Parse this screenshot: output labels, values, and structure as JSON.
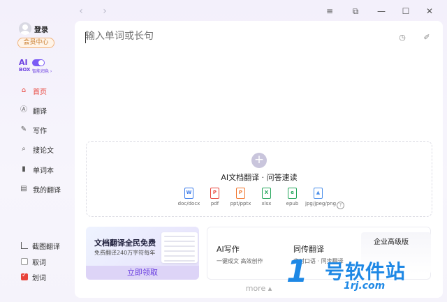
{
  "titlebar": {
    "back_icon": "chevron-left-icon",
    "forward_icon": "chevron-right-icon",
    "menu_icon": "hamburger-menu-icon",
    "pin_icon": "pin-window-icon",
    "minimize_icon": "minimize-icon",
    "maximize_icon": "maximize-icon",
    "close_icon": "close-icon"
  },
  "sidebar": {
    "login_label": "登录",
    "vip_label": "会员中心",
    "aibox": {
      "logo_line1": "AI",
      "logo_line2": "BOX",
      "subtitle": "智能润色 ›"
    },
    "nav_items": [
      {
        "label": "首页",
        "icon": "home-icon",
        "active": true
      },
      {
        "label": "翻译",
        "icon": "translate-icon",
        "active": false
      },
      {
        "label": "写作",
        "icon": "pen-icon",
        "active": false
      },
      {
        "label": "搜论文",
        "icon": "paper-search-icon",
        "active": false
      },
      {
        "label": "单词本",
        "icon": "wordbook-icon",
        "active": false
      },
      {
        "label": "我的翻译",
        "icon": "my-translation-icon",
        "active": false
      }
    ],
    "bottom_items": [
      {
        "label": "截图翻译",
        "icon": "crop-icon"
      },
      {
        "label": "取词",
        "checked": false
      },
      {
        "label": "划词",
        "checked": true
      }
    ]
  },
  "main": {
    "input_placeholder": "输入单词或长句",
    "history_icon": "clock-icon",
    "edit_icon": "edit-pen-icon",
    "drop_zone": {
      "plus_icon": "+",
      "title": "AI文档翻译 · 问答速读",
      "file_types": [
        {
          "label": "doc/docx",
          "glyph": "W",
          "color": "#3b7bea"
        },
        {
          "label": "pdf",
          "glyph": "P",
          "color": "#e8433a"
        },
        {
          "label": "ppt/pptx",
          "glyph": "P",
          "color": "#f0762e"
        },
        {
          "label": "xlsx",
          "glyph": "X",
          "color": "#23a55a"
        },
        {
          "label": "epub",
          "glyph": "e",
          "color": "#23a55a"
        },
        {
          "label": "jpg/jpeg/png",
          "glyph": "▲",
          "color": "#4b8fea"
        }
      ],
      "help_icon": "?"
    },
    "promo": {
      "title": "文档翻译全民免费",
      "subtitle": "免费翻译240万字符每年",
      "button": "立即领取"
    },
    "features": [
      {
        "title": "AI写作",
        "subtitle": "一键成文 高效创作"
      },
      {
        "title": "同传翻译",
        "subtitle": "实时口语 · 同步翻译"
      }
    ],
    "enterprise": "企业高级版",
    "more": "more ▴"
  },
  "watermark": {
    "digit": "1",
    "main": "号软件站",
    "sub": "1rj.com"
  }
}
